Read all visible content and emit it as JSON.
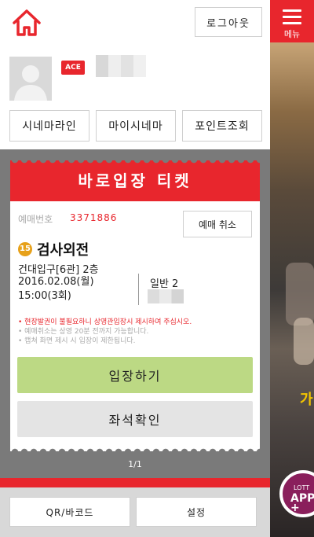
{
  "menu": {
    "label": "메뉴"
  },
  "header": {
    "logout_label": "로그아웃"
  },
  "profile": {
    "grade_badge": "ACE",
    "quick_buttons": [
      {
        "label": "시네마라인"
      },
      {
        "label": "마이시네마"
      },
      {
        "label": "포인트조회"
      }
    ]
  },
  "ticket": {
    "header_title": "바로입장 티켓",
    "reservation_label": "예매번호",
    "reservation_number": "3371886",
    "cancel_label": "예매 취소",
    "rating": "15",
    "movie_title": "검사외전",
    "theater": "건대입구[6관] 2층",
    "date": "2016.02.08(월)",
    "time": "15:00(3회)",
    "seat_type": "일반 2",
    "notices": [
      "• 현장발권이 불필요하니 상영관입장시 제시하여 주십시오.",
      "• 예매취소는 상영 20분 전까지 가능합니다.",
      "• 캡쳐 화면 제시 시 입장이 제한됩니다."
    ],
    "enter_label": "입장하기",
    "seat_check_label": "좌석확인",
    "page_indicator": "1/1"
  },
  "bottom": {
    "qr_label": "QR/바코드",
    "settings_label": "설정"
  },
  "background_page": {
    "promo_text": "가",
    "lotte_app_top": "LOTT",
    "lotte_app_main": "APP",
    "lotte_app_plus": "+"
  },
  "colors": {
    "accent_red": "#e8262d",
    "enter_green": "#bcd984",
    "ticket_bg_gray": "#7a7a7a",
    "rating_orange": "#e7a11a"
  }
}
